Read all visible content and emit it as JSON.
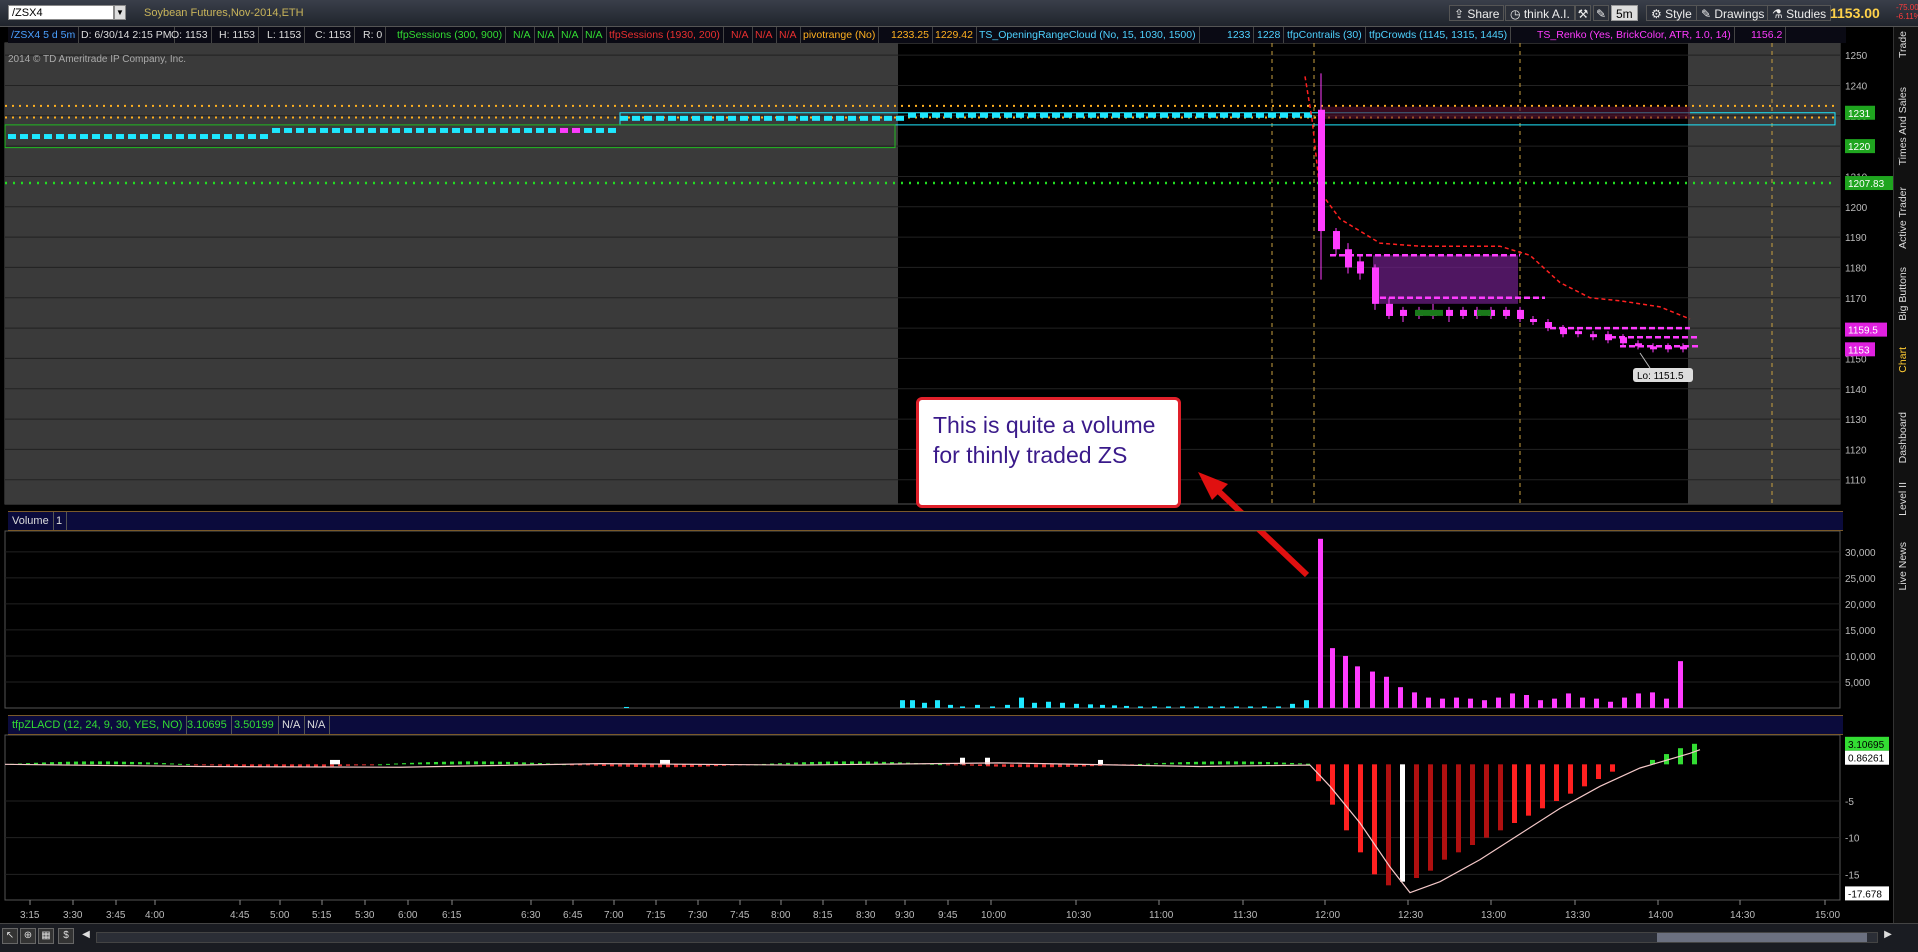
{
  "toolbar": {
    "symbol": "/ZSX4",
    "description": "Soybean Futures,Nov-2014,ETH",
    "share_label": "Share",
    "thinkai_label": "think A.I.",
    "timeframe": "5m",
    "style_label": "Style",
    "drawings_label": "Drawings",
    "studies_label": "Studies",
    "last_price": "1153.00",
    "net_change": "-75.00",
    "pct_change": "-6.11%"
  },
  "study_bar": [
    {
      "text": "/ZSX4 5 d 5m",
      "color": "#4aa0ff"
    },
    {
      "text": "D: 6/30/14 2:15 PM",
      "color": "#ddd"
    },
    {
      "text": "O: 1153",
      "color": "#ddd"
    },
    {
      "text": "H: 1153",
      "color": "#ddd"
    },
    {
      "text": "L: 1153",
      "color": "#ddd"
    },
    {
      "text": "C: 1153",
      "color": "#ddd"
    },
    {
      "text": "R: 0",
      "color": "#ddd"
    },
    {
      "text": "tfpSessions (300, 900)",
      "color": "#33dd33"
    },
    {
      "text": "N/A",
      "color": "#33dd33"
    },
    {
      "text": "N/A",
      "color": "#33dd33"
    },
    {
      "text": "N/A",
      "color": "#33dd33"
    },
    {
      "text": "N/A",
      "color": "#33dd33"
    },
    {
      "text": "tfpSessions (1930, 200)",
      "color": "#e83030"
    },
    {
      "text": "N/A",
      "color": "#e83030"
    },
    {
      "text": "N/A",
      "color": "#e83030"
    },
    {
      "text": "N/A",
      "color": "#e83030"
    },
    {
      "text": "pivotrange (No)",
      "color": "#ffb020"
    },
    {
      "text": "1233.25",
      "color": "#ffb020"
    },
    {
      "text": "1229.42",
      "color": "#ffb020"
    },
    {
      "text": "TS_OpeningRangeCloud (No, 15, 1030, 1500)",
      "color": "#4fd2ff"
    },
    {
      "text": "1233",
      "color": "#4fd2ff"
    },
    {
      "text": "1228",
      "color": "#4fd2ff"
    },
    {
      "text": "tfpContrails (30)",
      "color": "#4fd2ff"
    },
    {
      "text": "tfpCrowds (1145, 1315, 1445)",
      "color": "#4fd2ff"
    },
    {
      "text": "TS_Renko (Yes, BrickColor, ATR, 1.0, 14)",
      "color": "#ff3cff"
    },
    {
      "text": "1156.2",
      "color": "#ff3cff"
    }
  ],
  "watermark": "2014 © TD Ameritrade IP Company, Inc.",
  "price_axis": {
    "ticks": [
      1250,
      1240,
      1230,
      1220,
      1210,
      1200,
      1190,
      1180,
      1170,
      1160,
      1150,
      1140,
      1130,
      1120,
      1110
    ],
    "labels": [
      {
        "text": "1231",
        "value": 1231,
        "bg": "#1fa51f",
        "fg": "#fff"
      },
      {
        "text": "1220",
        "value": 1220,
        "bg": "#1fa51f",
        "fg": "#fff"
      },
      {
        "text": "1207.83",
        "value": 1207.83,
        "bg": "#1fa51f",
        "fg": "#fff"
      },
      {
        "text": "1159.5",
        "value": 1159.5,
        "bg": "#e020e0",
        "fg": "#fff"
      },
      {
        "text": "1153",
        "value": 1153,
        "bg": "#e020e0",
        "fg": "#fff"
      }
    ],
    "low_label": "Lo: 1151.5"
  },
  "volume_pane": {
    "title": "Volume",
    "tab": "1",
    "ticks": [
      "30,000",
      "25,000",
      "20,000",
      "15,000",
      "10,000",
      "5,000"
    ],
    "tick_values": [
      30000,
      25000,
      20000,
      15000,
      10000,
      5000
    ]
  },
  "zlacd_pane": {
    "title": "tfpZLACD (12, 24, 9, 30, YES, NO)",
    "value1": "3.10695",
    "value2": "3.50199",
    "na1": "N/A",
    "na2": "N/A",
    "ticks": [
      "-5",
      "-10",
      "-15"
    ],
    "tick_values": [
      -5,
      -10,
      -15
    ],
    "label_top": "3.10695",
    "label_mid": "0.86261",
    "label_bottom": "-17.678"
  },
  "time_axis": [
    "3:15",
    "3:30",
    "3:45",
    "4:00",
    "4:45",
    "5:00",
    "5:15",
    "5:30",
    "6:00",
    "6:15",
    "6:30",
    "6:45",
    "7:00",
    "7:15",
    "7:30",
    "7:45",
    "8:00",
    "8:15",
    "8:30",
    "9:30",
    "9:45",
    "10:00",
    "10:30",
    "11:00",
    "11:30",
    "12:00",
    "12:30",
    "13:00",
    "13:30",
    "14:00",
    "14:30",
    "15:00"
  ],
  "callout": {
    "text": "This is quite a volume for thinly traded ZS"
  },
  "side_tabs": [
    "Trade",
    "Times And Sales",
    "Active Trader",
    "Big Buttons",
    "Chart",
    "Dashboard",
    "Level II",
    "Live News"
  ],
  "colors": {
    "accent": "#ff3cff",
    "up": "#33dd33",
    "down": "#e83030",
    "cyan": "#1ee8ff",
    "orange": "#ffb020"
  }
}
